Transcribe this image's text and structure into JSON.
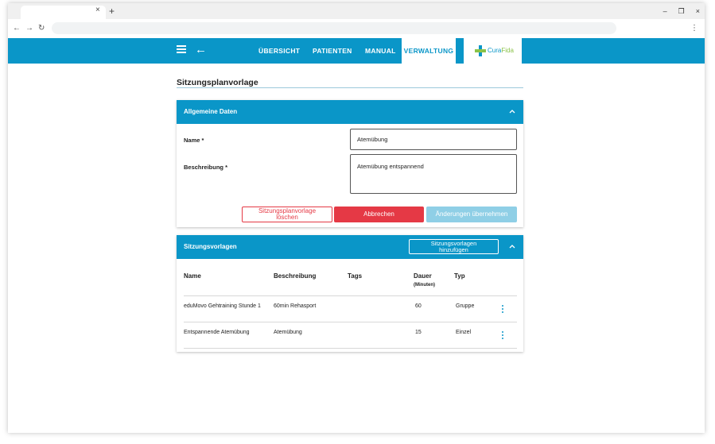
{
  "browser": {
    "tab_close": "×",
    "new_tab": "+",
    "minimize": "–",
    "restore": "❐",
    "close": "×",
    "back": "←",
    "forward": "→",
    "reload": "↻",
    "menu": "⋮"
  },
  "header": {
    "nav": [
      "ÜBERSICHT",
      "PATIENTEN",
      "MANUAL",
      "VERWALTUNG"
    ],
    "active_nav": "VERWALTUNG",
    "logo_cura": "Cura",
    "logo_fida": "Fida",
    "accent_color": "#0a96c8"
  },
  "page": {
    "title": "Sitzungsplanvorlage"
  },
  "general": {
    "title": "Allgemeine Daten",
    "name_label": "Name *",
    "name_value": "Atemübung",
    "description_label": "Beschreibung *",
    "description_value": "Atemübung entspannend",
    "delete_line1": "Sitzungsplanvorlage",
    "delete_line2": "löschen",
    "cancel": "Abbrechen",
    "apply": "Änderungen übernehmen"
  },
  "sessions": {
    "title": "Sitzungsvorlagen",
    "add_line1": "Sitzungsvorlagen",
    "add_line2": "hinzufügen",
    "columns": {
      "name": "Name",
      "description": "Beschreibung",
      "tags": "Tags",
      "duration": "Dauer",
      "duration_unit": "(Minuten)",
      "type": "Typ"
    },
    "rows": [
      {
        "name": "eduMovo Gehtraining Stunde 1",
        "description": "60min Rehasport",
        "tags": "",
        "duration": "60",
        "type": "Gruppe"
      },
      {
        "name": "Entspannende Atemübung",
        "description": "Atemübung",
        "tags": "",
        "duration": "15",
        "type": "Einzel"
      }
    ]
  }
}
